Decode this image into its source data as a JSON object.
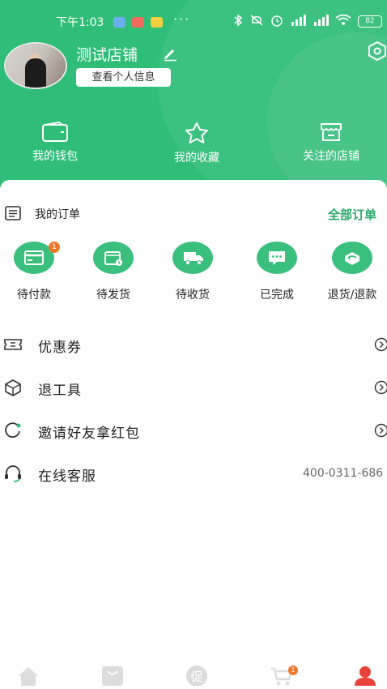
{
  "status_bar": {
    "time": "下午1:03",
    "dots": "···",
    "battery": "82"
  },
  "profile": {
    "shop_name": "测试店铺",
    "view_info_label": "查看个人信息"
  },
  "quick_links": [
    {
      "label": "我的钱包",
      "icon": "wallet-icon"
    },
    {
      "label": "我的收藏",
      "icon": "star-icon"
    },
    {
      "label": "关注的店铺",
      "icon": "store-icon"
    }
  ],
  "orders": {
    "title": "我的订单",
    "all_label": "全部订单",
    "items": [
      {
        "label": "待付款",
        "icon": "card-icon",
        "badge": "1"
      },
      {
        "label": "待发货",
        "icon": "package-icon"
      },
      {
        "label": "待收货",
        "icon": "truck-icon"
      },
      {
        "label": "已完成",
        "icon": "chat-icon"
      },
      {
        "label": "退货/退款",
        "icon": "return-icon"
      }
    ]
  },
  "menu": [
    {
      "label": "优惠券",
      "icon": "coupon-icon"
    },
    {
      "label": "退工具",
      "icon": "box-icon"
    },
    {
      "label": "邀请好友拿红包",
      "icon": "refresh-icon"
    },
    {
      "label": "在线客服",
      "icon": "headset-icon",
      "value": "400-0311-686"
    }
  ],
  "tabbar": {
    "tabs": [
      {
        "icon": "home-icon"
      },
      {
        "icon": "bag-icon"
      },
      {
        "icon": "promo-icon",
        "glyph": "促"
      },
      {
        "icon": "cart-icon",
        "badge": "1"
      },
      {
        "icon": "user-icon"
      }
    ]
  },
  "colors": {
    "primary": "#2fbd78",
    "accent_text": "#2aa76a",
    "badge": "#f07a2a"
  }
}
